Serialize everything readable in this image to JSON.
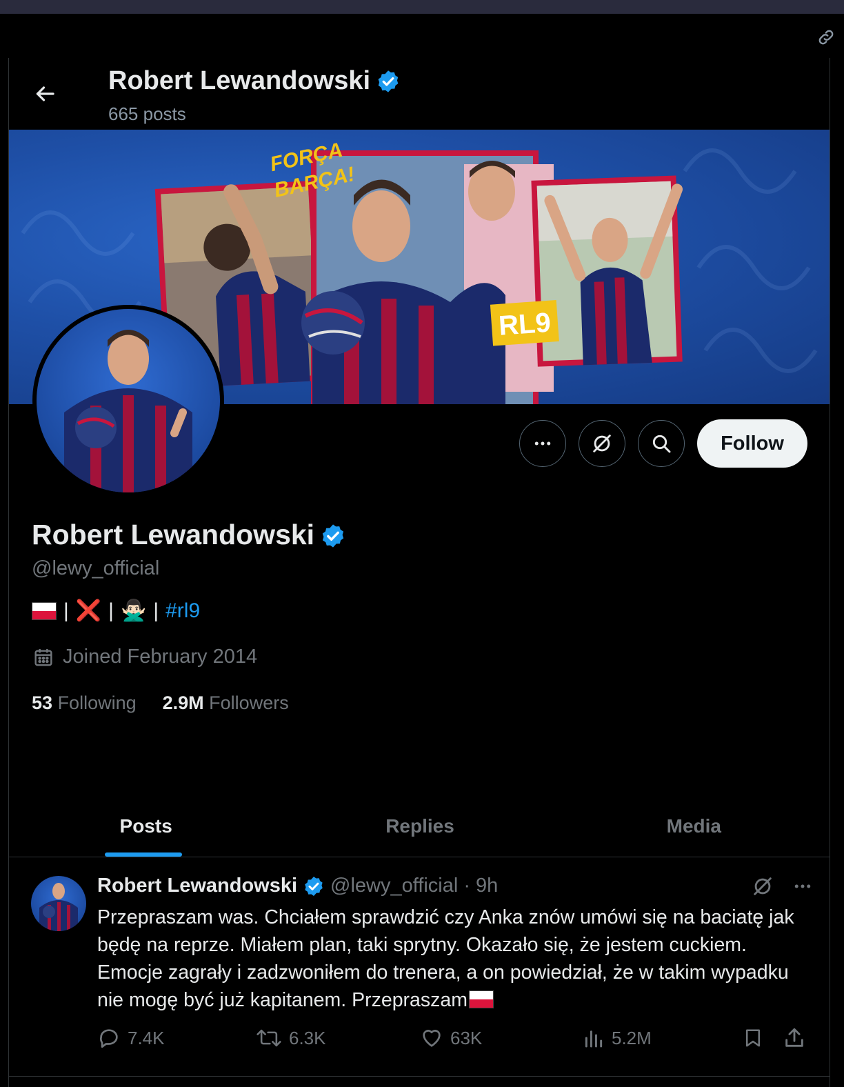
{
  "header": {
    "name": "Robert Lewandowski",
    "post_count": "665 posts"
  },
  "actions": {
    "follow_label": "Follow"
  },
  "profile": {
    "name": "Robert Lewandowski",
    "handle": "@lewy_official",
    "bio": {
      "sep1": "|",
      "emoji_x": "❌",
      "sep2": "|",
      "emoji_person": "🙅🏻‍♂️",
      "sep3": "|",
      "hashtag": "#rl9"
    },
    "joined": "Joined February 2014",
    "following_count": "53",
    "following_label": "Following",
    "followers_count": "2.9M",
    "followers_label": "Followers"
  },
  "banner": {
    "slogan_line1": "FORÇA",
    "slogan_line2": "BARÇA!",
    "badge": "RL9"
  },
  "tabs": [
    {
      "label": "Posts",
      "active": true
    },
    {
      "label": "Replies",
      "active": false
    },
    {
      "label": "Media",
      "active": false
    }
  ],
  "post": {
    "name": "Robert Lewandowski",
    "handle": "@lewy_official",
    "dot": "·",
    "time": "9h",
    "text": "Przepraszam was. Chciałem sprawdzić czy Anka znów umówi się na baciatę jak będę na reprze. Miałem plan, taki sprytny. Okazało się, że jestem cuckiem. Emocje zagrały i zadzwoniłem do trenera, a on powiedział, że w takim wypadku nie mogę być już kapitanem. Przepraszam",
    "replies": "7.4K",
    "reposts": "6.3K",
    "likes": "63K",
    "views": "5.2M"
  },
  "colors": {
    "accent": "#1d9bf0",
    "muted": "#71767b",
    "text": "#e7e9ea",
    "background": "#000000"
  }
}
